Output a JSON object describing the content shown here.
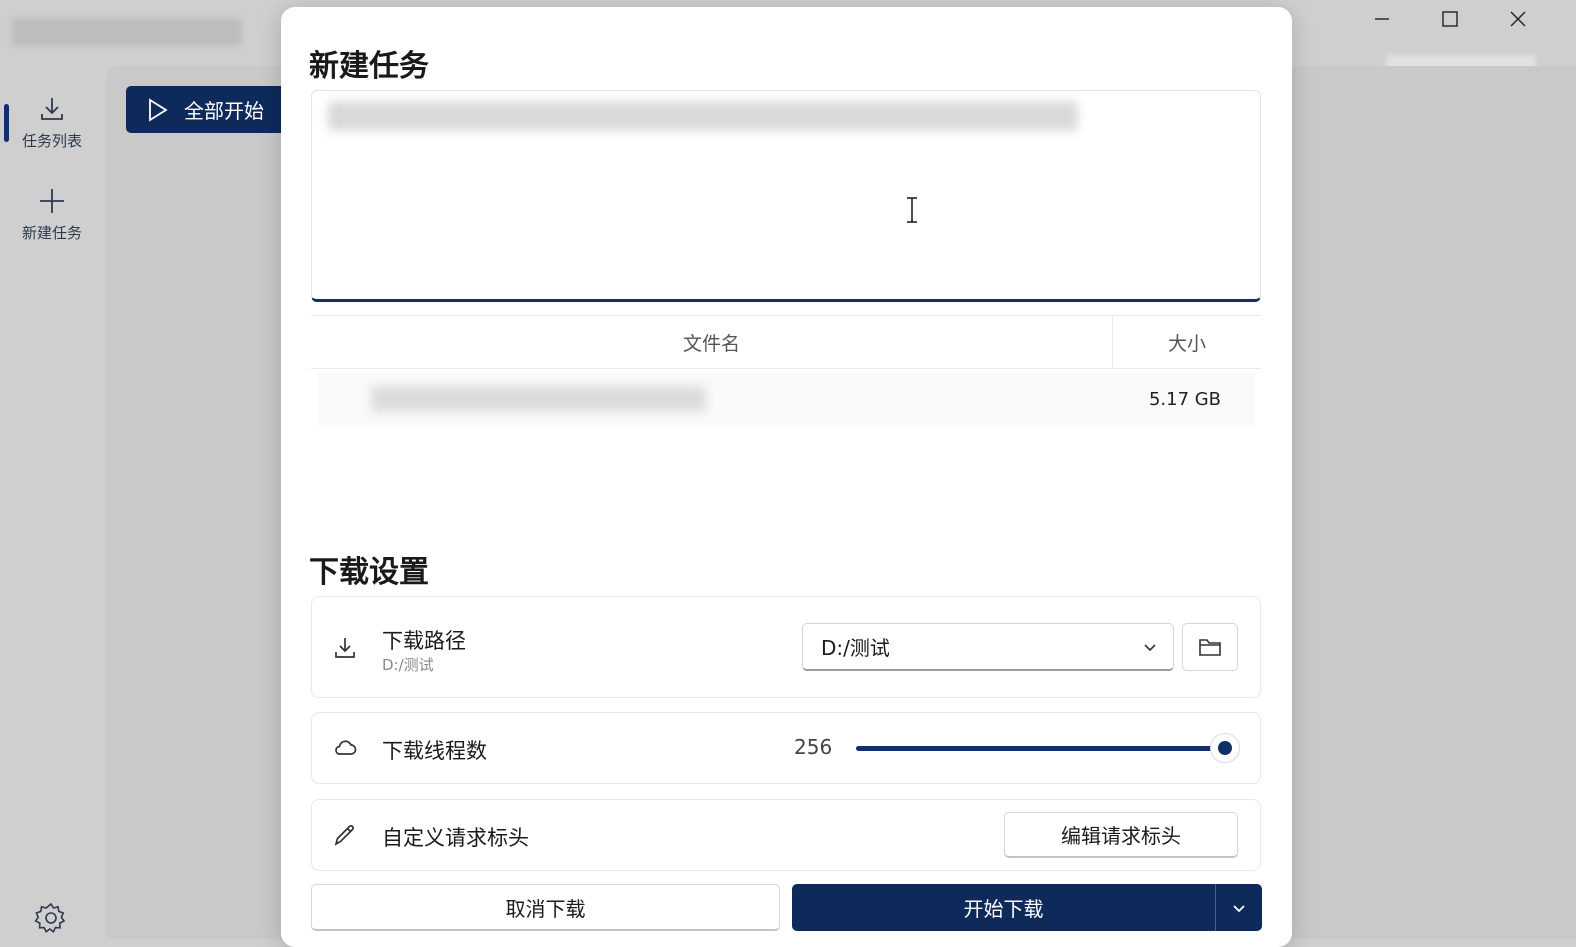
{
  "window": {
    "controls": [
      "minimize-icon",
      "maximize-icon",
      "close-icon"
    ]
  },
  "sidebar": {
    "items": [
      {
        "label": "任务列表",
        "icon": "download-icon",
        "active": true
      },
      {
        "label": "新建任务",
        "icon": "plus-icon",
        "active": false
      }
    ],
    "settings_icon": "gear-icon"
  },
  "toolbar": {
    "start_all_label": "全部开始"
  },
  "dialog": {
    "title": "新建任务",
    "file_table": {
      "headers": {
        "name": "文件名",
        "size": "大小"
      },
      "rows": [
        {
          "size": "5.17 GB"
        }
      ]
    },
    "settings_title": "下载设置",
    "download_path": {
      "label": "下载路径",
      "sub": "D:/测试",
      "selected": "D:/测试"
    },
    "threads": {
      "label": "下载线程数",
      "value": "256",
      "level": 1.0
    },
    "headers": {
      "label": "自定义请求标头",
      "button_label": "编辑请求标头"
    },
    "buttons": {
      "cancel": "取消下载",
      "start": "开始下载"
    }
  },
  "colors": {
    "accent": "#0e2a5a",
    "background": "#cfcfcf",
    "dialog": "#ffffff"
  }
}
